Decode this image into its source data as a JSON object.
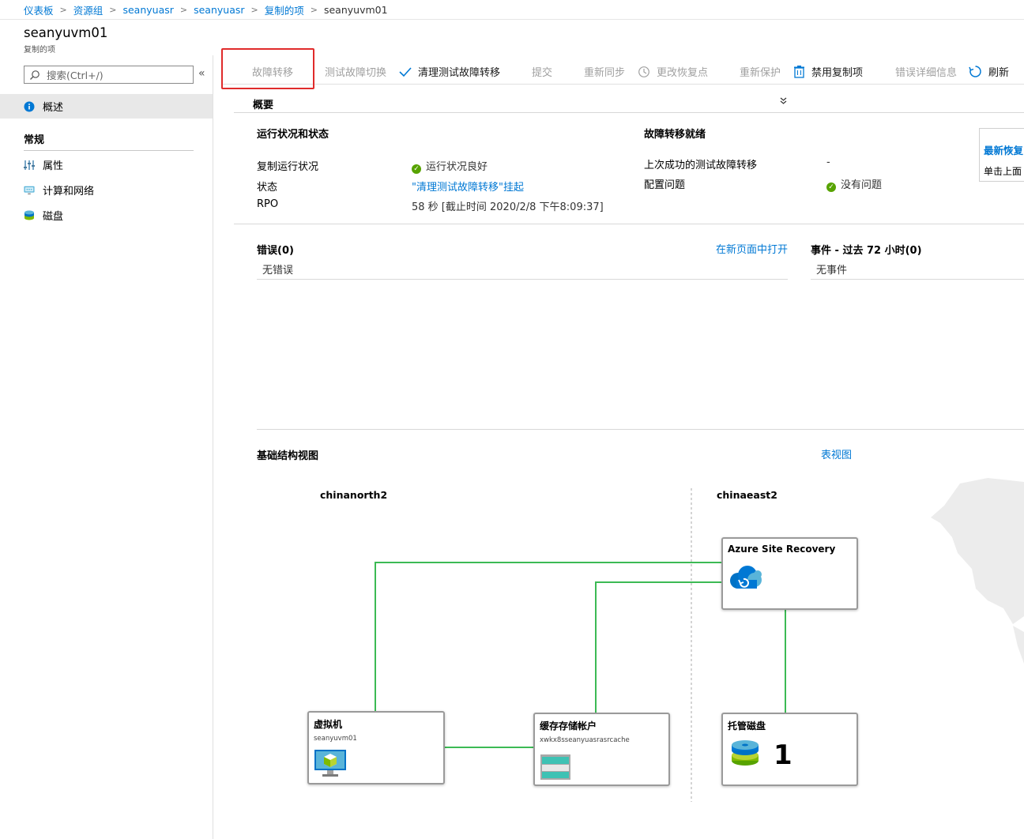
{
  "breadcrumb": [
    "仪表板",
    "资源组",
    "seanyuasr",
    "seanyuasr",
    "复制的项",
    "seanyuvm01"
  ],
  "page": {
    "title": "seanyuvm01",
    "subtitle": "复制的项"
  },
  "search": {
    "placeholder": "搜索(Ctrl+/)"
  },
  "nav": {
    "overview": "概述",
    "group": "常规",
    "items": [
      "属性",
      "计算和网络",
      "磁盘"
    ]
  },
  "toolbar": {
    "failover": "故障转移",
    "test_failover": "测试故障切换",
    "cleanup": "清理测试故障转移",
    "commit": "提交",
    "resync": "重新同步",
    "change_recovery": "更改恢复点",
    "reprotect": "重新保护",
    "disable": "禁用复制项",
    "error_details": "错误详细信息",
    "refresh": "刷新"
  },
  "summary": {
    "header": "概要",
    "health_title": "运行状况和状态",
    "rows": [
      {
        "label": "复制运行状况",
        "value": "运行状况良好"
      },
      {
        "label": "状态",
        "value": "\"清理测试故障转移\"挂起"
      },
      {
        "label": "RPO",
        "value": "58 秒 [截止时间 2020/2/8 下午8:09:37]"
      }
    ],
    "readiness_title": "故障转移就绪",
    "readiness_rows": [
      {
        "label": "上次成功的测试故障转移",
        "value": "-"
      },
      {
        "label": "配置问题",
        "value": "没有问题"
      }
    ],
    "side_card": {
      "title": "最新恢复",
      "text": "单击上面"
    }
  },
  "errors": {
    "title": "错误(0)",
    "open_link": "在新页面中打开",
    "empty": "无错误"
  },
  "events": {
    "title": "事件 - 过去 72 小时(0)",
    "empty": "无事件"
  },
  "infra": {
    "title": "基础结构视图",
    "table_view": "表视图",
    "region_left": "chinanorth2",
    "region_right": "chinaeast2",
    "asr": "Azure Site Recovery",
    "vm": {
      "title": "虚拟机",
      "name": "seanyuvm01"
    },
    "cache": {
      "title": "缓存存储帐户",
      "name": "xwkx8sseanyuasrasrcache"
    },
    "disk": {
      "title": "托管磁盘",
      "count": "1"
    }
  },
  "colors": {
    "accent": "#0078d4",
    "ok": "#57a300",
    "line": "#3cba54",
    "highlight": "#e02b2b"
  }
}
